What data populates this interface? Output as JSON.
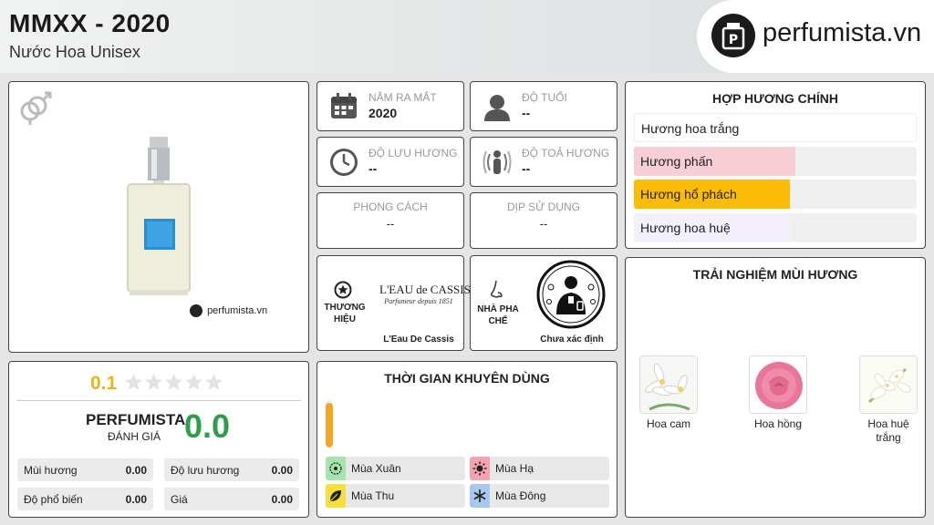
{
  "header": {
    "title": "MMXX - 2020",
    "subtitle": "Nước Hoa Unisex",
    "logo_text": "perfumista.vn"
  },
  "product": {
    "watermark": "perfumista.vn",
    "gender_icon": "unisex-gender-icon"
  },
  "stats": {
    "year_label": "NĂM RA MẮT",
    "year_value": "2020",
    "age_label": "ĐỘ TUỔI",
    "age_value": "--",
    "longevity_label": "ĐỘ LƯU HƯƠNG",
    "longevity_value": "--",
    "sillage_label": "ĐỘ TOẢ HƯƠNG",
    "sillage_value": "--",
    "style_label": "PHONG CÁCH",
    "style_value": "--",
    "occasion_label": "DỊP SỬ DỤNG",
    "occasion_value": "--"
  },
  "brand": {
    "section_label": "THƯƠNG HIỆU",
    "name": "L'Eau De Cassis",
    "logo_line1": "L'EAU de CASSIS",
    "logo_line2": "Parfumeur depuis 1851"
  },
  "perfumer": {
    "section_label": "NHÀ PHA CHẾ",
    "name": "Chưa xác định"
  },
  "accords": {
    "title": "HỢP HƯƠNG CHÍNH",
    "items": [
      {
        "label": "Hương hoa trắng",
        "strength": 0,
        "color": "#ffffff"
      },
      {
        "label": "Hương phấn",
        "strength": 0.57,
        "color": "#f7cdd6"
      },
      {
        "label": "Hương hổ phách",
        "strength": 0.55,
        "color": "#fbbc05"
      },
      {
        "label": "Hương hoa huệ",
        "strength": 0.55,
        "color": "#f3f0fb"
      }
    ]
  },
  "experience": {
    "title": "TRẢI NGHIỆM MÙI HƯƠNG",
    "notes": [
      {
        "label": "Hoa cam",
        "icon": "orange-blossom-image"
      },
      {
        "label": "Hoa hồng",
        "icon": "rose-image"
      },
      {
        "label": "Hoa huệ trắng",
        "icon": "tuberose-image"
      }
    ]
  },
  "rating": {
    "user_score": "0.1",
    "stars_filled": 0,
    "brand_label": "PERFUMISTA",
    "sub_label": "ĐÁNH GIÁ",
    "score": "0.0",
    "items": [
      {
        "label": "Mùi hương",
        "value": "0.00"
      },
      {
        "label": "Độ lưu hương",
        "value": "0.00"
      },
      {
        "label": "Độ phổ biến",
        "value": "0.00"
      },
      {
        "label": "Giá",
        "value": "0.00"
      }
    ]
  },
  "usage": {
    "title": "THỜI GIAN KHUYÊN DÙNG",
    "day_level": 0.95,
    "seasons": [
      {
        "label": "Mùa Xuân",
        "color": "#a6e3b1"
      },
      {
        "label": "Mùa Hạ",
        "color": "#f5a3b3"
      },
      {
        "label": "Mùa Thu",
        "color": "#f7df3c"
      },
      {
        "label": "Mùa Đông",
        "color": "#a9c8ef"
      }
    ]
  },
  "colors": {
    "accent_orange": "#f5a623",
    "score_green": "#2e9e4a",
    "score_yellow": "#f2b01e"
  }
}
